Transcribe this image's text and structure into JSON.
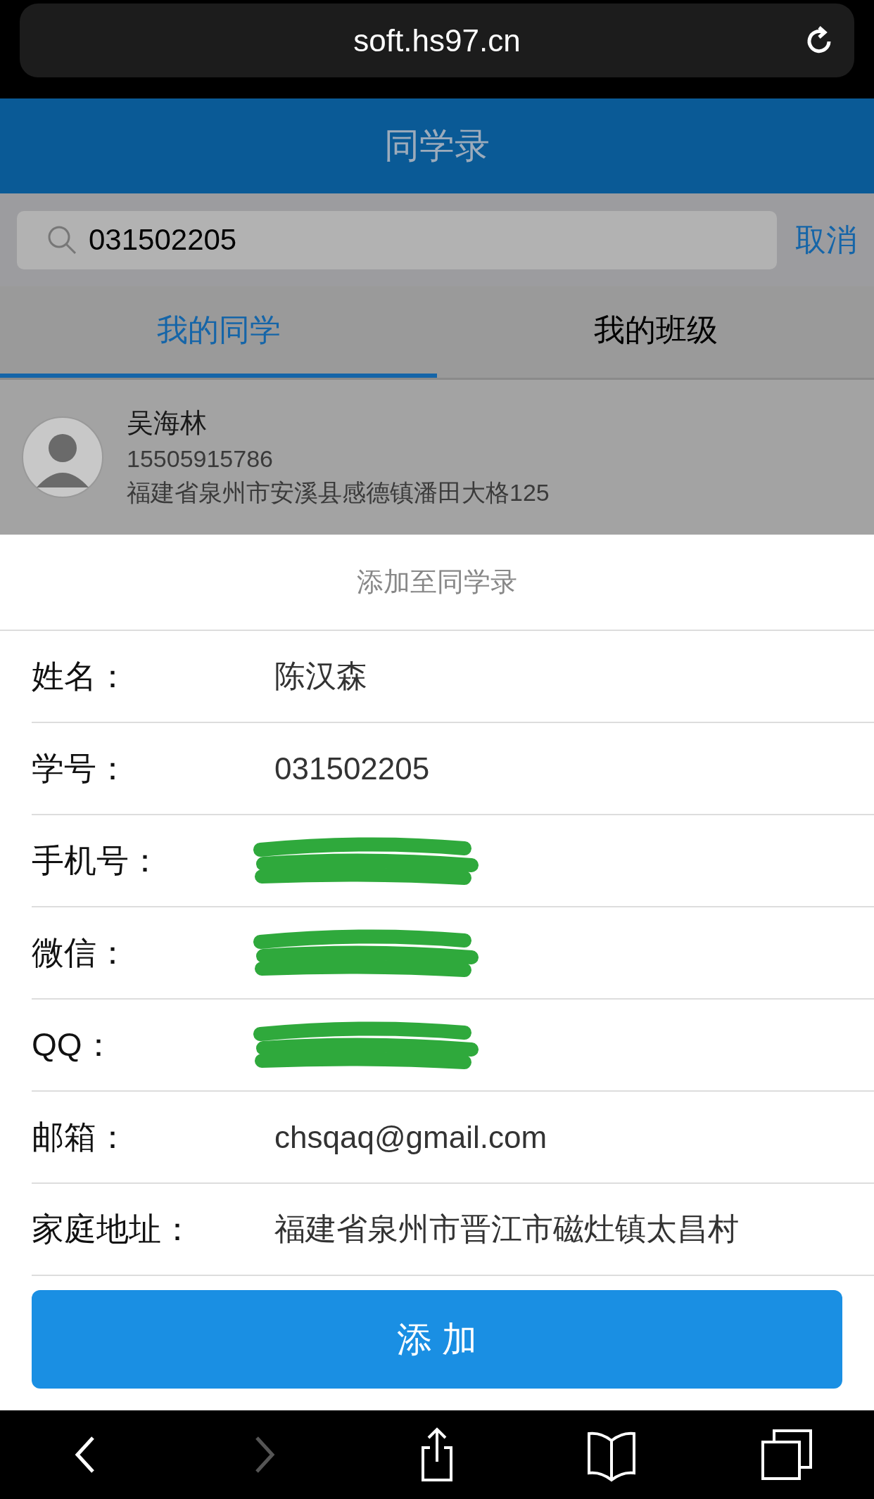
{
  "browser": {
    "url": "soft.hs97.cn"
  },
  "header": {
    "title": "同学录"
  },
  "search": {
    "value": "031502205",
    "cancel": "取消"
  },
  "tabs": [
    {
      "label": "我的同学",
      "selected": true
    },
    {
      "label": "我的班级",
      "selected": false
    }
  ],
  "results": [
    {
      "name": "吴海林",
      "phone": "15505915786",
      "address": "福建省泉州市安溪县感德镇潘田大格125"
    }
  ],
  "sheet": {
    "title": "添加至同学录",
    "fields": [
      {
        "label": "姓名：",
        "value": "陈汉森",
        "redacted": false
      },
      {
        "label": "学号：",
        "value": "031502205",
        "redacted": false
      },
      {
        "label": "手机号：",
        "redacted": true
      },
      {
        "label": "微信：",
        "redacted": true
      },
      {
        "label": "QQ：",
        "redacted": true
      },
      {
        "label": "邮箱：",
        "value": "chsqaq@gmail.com",
        "redacted": false
      },
      {
        "label": "家庭地址：",
        "value": "福建省泉州市晋江市磁灶镇太昌村",
        "redacted": false
      }
    ],
    "button": "添 加"
  },
  "toolbar": [
    {
      "kind": "back",
      "disabled": false
    },
    {
      "kind": "forward",
      "disabled": true
    },
    {
      "kind": "share",
      "disabled": false
    },
    {
      "kind": "bookmarks",
      "disabled": false
    },
    {
      "kind": "tabs",
      "disabled": false
    }
  ]
}
